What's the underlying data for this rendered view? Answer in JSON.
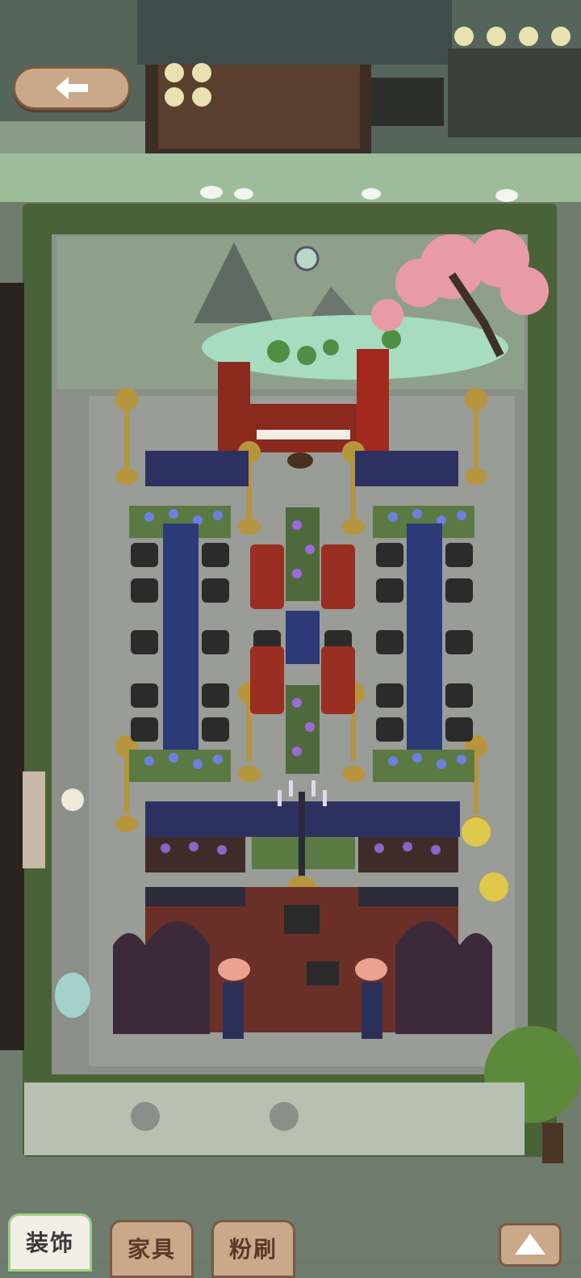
{
  "scene": {
    "name": "courtyard-garden",
    "colors": {
      "ground": "#8c918a",
      "hedge": "#4f6b3a",
      "flower_yellow": "#d9c24a",
      "water": "#a7d7b6",
      "sakura": "#e89aa7",
      "bench_blue": "#2d3a78",
      "chair_black": "#2a2a2a",
      "piano_red": "#8a2a1f",
      "lamp_gold": "#b7953c"
    }
  },
  "buttons": {
    "back_icon": "arrow-left-icon",
    "collapse_icon": "triangle-up-icon"
  },
  "tabs": [
    {
      "label": "装饰",
      "active": true
    },
    {
      "label": "家具",
      "active": false
    },
    {
      "label": "粉刷",
      "active": false
    }
  ]
}
